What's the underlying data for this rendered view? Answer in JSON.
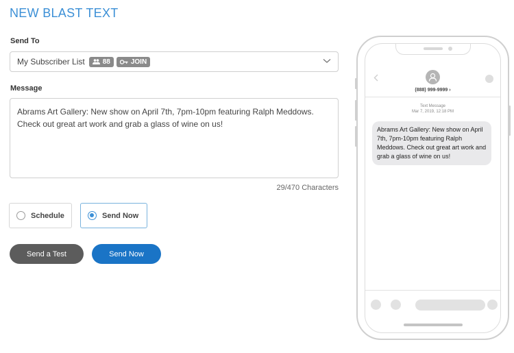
{
  "page": {
    "title": "NEW BLAST TEXT"
  },
  "send_to": {
    "label": "Send To",
    "selected_list": "My Subscriber List",
    "subscriber_count": "88",
    "keyword": "JOIN"
  },
  "message": {
    "label": "Message",
    "value": "Abrams Art Gallery: New show on April 7th, 7pm-10pm featuring Ralph Meddows.\nCheck out great art work and grab a glass of wine on us!",
    "char_count": "29/470 Characters"
  },
  "timing": {
    "schedule_label": "Schedule",
    "send_now_label": "Send Now",
    "selected": "send_now"
  },
  "actions": {
    "test_label": "Send a Test",
    "send_label": "Send Now"
  },
  "preview": {
    "phone_number": "(888) 999-9999 ›",
    "meta_type": "Text Message",
    "meta_time": "Mar 7, 2019, 12:18 PM",
    "bubble_text": "Abrams Art Gallery: New show on April 7th, 7pm-10pm featuring Ralph Meddows. Check out great art work and grab a glass of wine on us!"
  },
  "colors": {
    "accent": "#3b8fd6",
    "primary_button": "#1a74c6",
    "secondary_button": "#5c5c5c"
  },
  "icons": {
    "subscribers": "people-icon",
    "keyword": "key-icon",
    "dropdown": "chevron-down-icon",
    "back": "chevron-left-icon",
    "contact": "person-icon"
  }
}
